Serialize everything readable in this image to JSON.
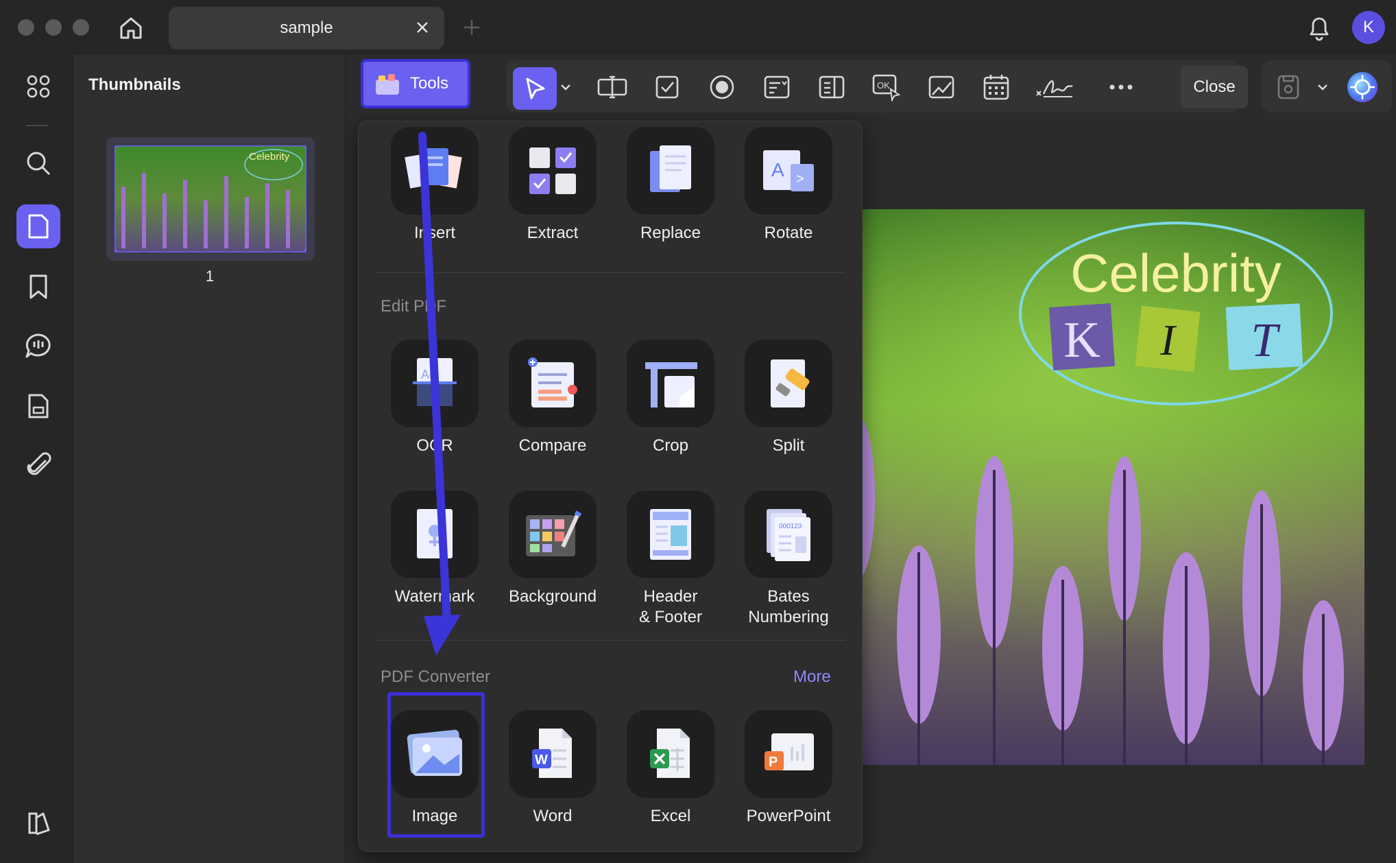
{
  "window": {
    "tab_title": "sample",
    "avatar_initial": "K"
  },
  "thumbnails": {
    "title": "Thumbnails",
    "page_number": "1",
    "thumb_caption": "Celebrity"
  },
  "toolbar": {
    "tools_label": "Tools",
    "close_label": "Close"
  },
  "dropdown": {
    "page_tools": [
      {
        "label": "Insert",
        "icon": "insert-icon"
      },
      {
        "label": "Extract",
        "icon": "extract-icon"
      },
      {
        "label": "Replace",
        "icon": "replace-icon"
      },
      {
        "label": "Rotate",
        "icon": "rotate-icon"
      }
    ],
    "edit_title": "Edit PDF",
    "edit_tools_row1": [
      {
        "label": "OCR",
        "icon": "ocr-icon"
      },
      {
        "label": "Compare",
        "icon": "compare-icon"
      },
      {
        "label": "Crop",
        "icon": "crop-icon"
      },
      {
        "label": "Split",
        "icon": "split-icon"
      }
    ],
    "edit_tools_row2": [
      {
        "label": "Watermark",
        "icon": "watermark-icon"
      },
      {
        "label": "Background",
        "icon": "background-icon"
      },
      {
        "label": "Header\n& Footer",
        "icon": "header-footer-icon"
      },
      {
        "label": "Bates\nNumbering",
        "icon": "bates-numbering-icon"
      }
    ],
    "converter_title": "PDF Converter",
    "more_label": "More",
    "converter_tools": [
      {
        "label": "Image",
        "icon": "image-icon"
      },
      {
        "label": "Word",
        "icon": "word-icon"
      },
      {
        "label": "Excel",
        "icon": "excel-icon"
      },
      {
        "label": "PowerPoint",
        "icon": "powerpoint-icon"
      }
    ]
  },
  "document": {
    "title_text": "Celebrity",
    "letters": [
      "K",
      "I",
      "T"
    ]
  },
  "colors": {
    "accent": "#6a61f0",
    "highlight": "#3b2fd6",
    "arrow": "#3b34d9"
  }
}
